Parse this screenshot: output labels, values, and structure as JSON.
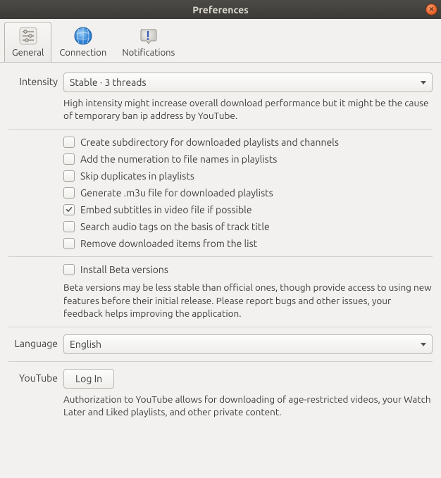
{
  "window": {
    "title": "Preferences"
  },
  "tabs": {
    "general": "General",
    "connection": "Connection",
    "notifications": "Notifications"
  },
  "intensity": {
    "label": "Intensity",
    "value": "Stable · 3 threads",
    "help": "High intensity might increase overall download performance but it might be the cause of temporary ban ip address by YouTube."
  },
  "opts": {
    "subdir": {
      "label": "Create subdirectory for downloaded playlists and channels",
      "checked": false
    },
    "numeration": {
      "label": "Add the numeration to file names in playlists",
      "checked": false
    },
    "skipdup": {
      "label": "Skip duplicates in playlists",
      "checked": false
    },
    "m3u": {
      "label": "Generate .m3u file for downloaded playlists",
      "checked": false
    },
    "embedsubs": {
      "label": "Embed subtitles in video file if possible",
      "checked": true
    },
    "audiotags": {
      "label": "Search audio tags on the basis of track title",
      "checked": false
    },
    "removedl": {
      "label": "Remove downloaded items from the list",
      "checked": false
    }
  },
  "beta": {
    "label": "Install Beta versions",
    "checked": false,
    "help": "Beta versions may be less stable than official ones, though provide access to using new features before their initial release. Please report bugs and other issues, your feedback helps improving the application."
  },
  "language": {
    "label": "Language",
    "value": "English"
  },
  "youtube": {
    "label": "YouTube",
    "button": "Log In",
    "help": "Authorization to YouTube allows for downloading of age-restricted videos, your Watch Later and Liked playlists, and other private content."
  }
}
